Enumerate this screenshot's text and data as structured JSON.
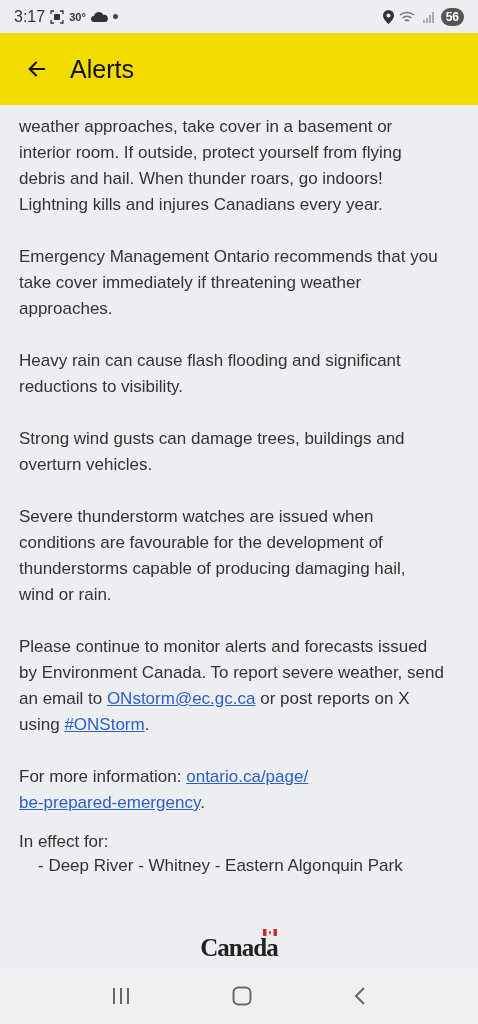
{
  "status_bar": {
    "time": "3:17",
    "temperature": "30°",
    "battery": "56"
  },
  "app_bar": {
    "title": "Alerts"
  },
  "paragraphs": [
    {
      "segments": [
        {
          "kind": "text",
          "text": "weather approaches, take cover in a basement or interior room. If outside, protect yourself from flying debris and hail. When thunder roars, go indoors! Lightning kills and injures Canadians every year."
        }
      ]
    },
    {
      "segments": [
        {
          "kind": "text",
          "text": "Emergency Management Ontario recommends that you take cover immediately if threatening weather approaches."
        }
      ]
    },
    {
      "segments": [
        {
          "kind": "text",
          "text": "Heavy rain can cause flash flooding and significant reductions to visibility."
        }
      ]
    },
    {
      "segments": [
        {
          "kind": "text",
          "text": "Strong wind gusts can damage trees, buildings and overturn vehicles."
        }
      ]
    },
    {
      "segments": [
        {
          "kind": "text",
          "text": "Severe thunderstorm watches are issued when conditions are favourable for the development of thunderstorms capable of producing damaging hail, wind or rain."
        }
      ]
    },
    {
      "segments": [
        {
          "kind": "text",
          "text": "Please continue to monitor alerts and forecasts issued by Environment Canada. To report severe weather, send an email to "
        },
        {
          "kind": "link",
          "text": "ONstorm@ec.gc.ca"
        },
        {
          "kind": "text",
          "text": " or post reports on X using "
        },
        {
          "kind": "link",
          "text": "#ONStorm"
        },
        {
          "kind": "text",
          "text": "."
        }
      ]
    },
    {
      "segments": [
        {
          "kind": "text",
          "text": "For more information: "
        },
        {
          "kind": "link",
          "text": "ontario.ca/page/"
        },
        {
          "kind": "link",
          "text": "be-prepared-emergency"
        },
        {
          "kind": "text",
          "text": "."
        }
      ]
    }
  ],
  "effect": {
    "label": "In effect for:",
    "areas": [
      "- Deep River - Whitney - Eastern Algonquin Park"
    ]
  },
  "wordmark": "Canada"
}
